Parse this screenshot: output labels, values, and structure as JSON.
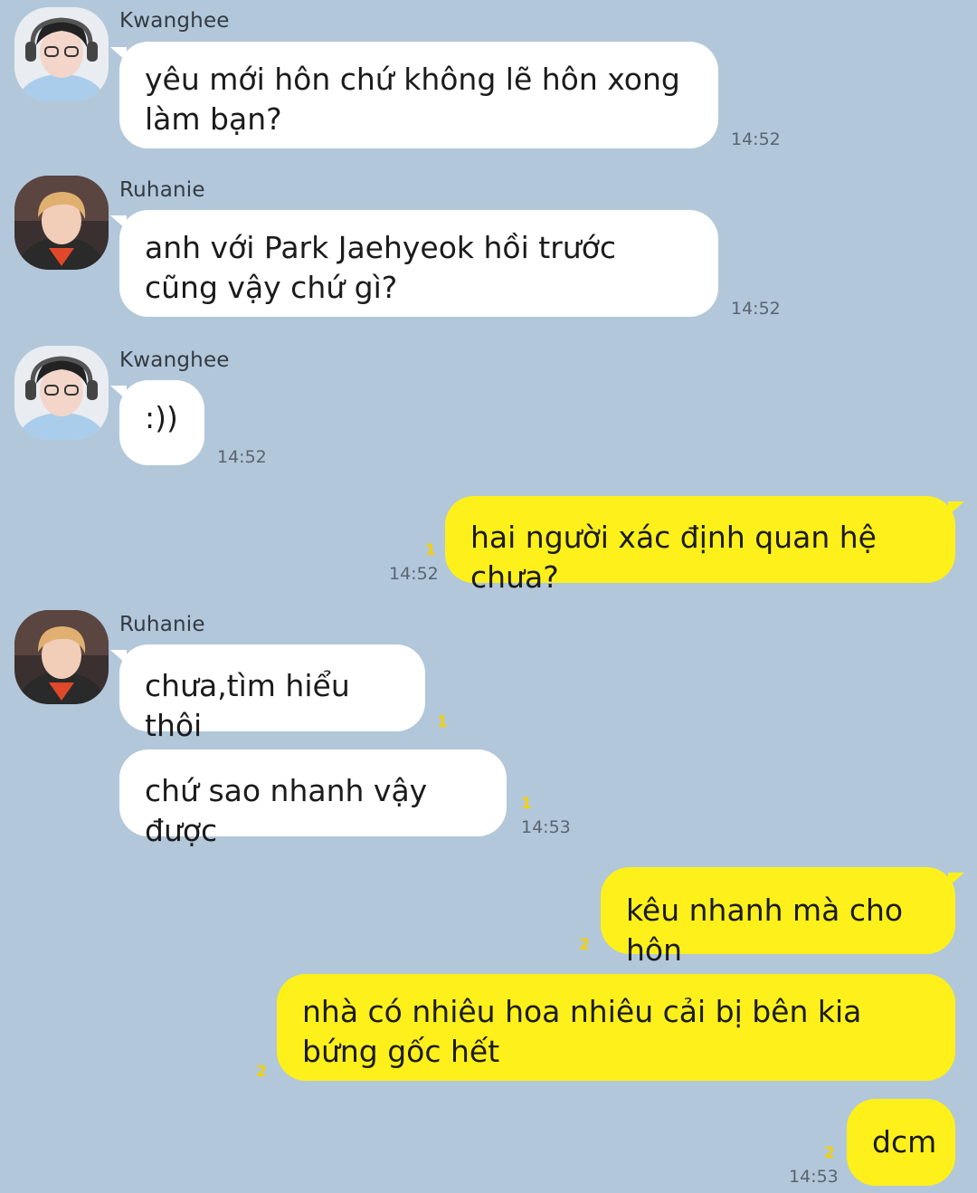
{
  "colors": {
    "background": "#b2c7da",
    "incoming_bubble": "#ffffff",
    "outgoing_bubble": "#fef01b",
    "unread_count": "#f4d000"
  },
  "messages": [
    {
      "sender": "Kwanghee",
      "avatar": "avatar-kwanghee",
      "text": "yêu mới hôn chứ không lẽ hôn xong làm bạn?",
      "time": "14:52"
    },
    {
      "sender": "Ruhanie",
      "avatar": "avatar-ruhanie",
      "text": "anh với Park Jaehyeok hồi trước cũng vậy chứ gì?",
      "time": "14:52"
    },
    {
      "sender": "Kwanghee",
      "avatar": "avatar-kwanghee",
      "text": ":))",
      "time": "14:52"
    },
    {
      "sender": "me",
      "text": "hai người xác định quan hệ chưa?",
      "unread": "1",
      "time": "14:52"
    },
    {
      "sender": "Ruhanie",
      "avatar": "avatar-ruhanie",
      "text": "chưa,tìm hiểu thôi",
      "unread": "1"
    },
    {
      "sender": "Ruhanie",
      "text": "chứ sao nhanh vậy được",
      "unread": "1",
      "time": "14:53"
    },
    {
      "sender": "me",
      "text": "kêu nhanh mà cho hôn",
      "unread": "2"
    },
    {
      "sender": "me",
      "text": "nhà có nhiêu hoa nhiêu cải bị bên kia bứng gốc hết",
      "unread": "2"
    },
    {
      "sender": "me",
      "text": "dcm",
      "unread": "2",
      "time": "14:53"
    }
  ]
}
